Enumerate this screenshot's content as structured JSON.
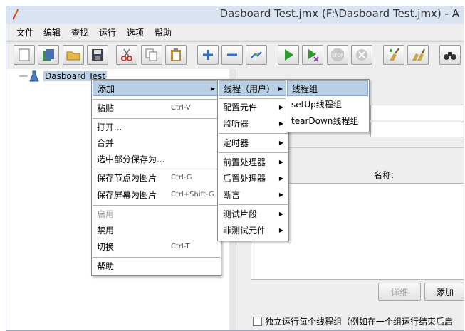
{
  "window": {
    "title": "Dasboard Test.jmx (F:\\Dasboard Test.jmx) - A"
  },
  "menubar": [
    "文件",
    "编辑",
    "查找",
    "运行",
    "选项",
    "帮助"
  ],
  "toolbar": [
    "new-icon",
    "templates-icon",
    "open-icon",
    "save-icon",
    "cut-icon",
    "copy-icon",
    "paste-icon",
    "expand-icon",
    "collapse-icon",
    "toggle-icon",
    "start-icon",
    "start-no-pause-icon",
    "stop-icon",
    "shutdown-icon",
    "clear-icon",
    "clear-all-icon",
    "search-icon"
  ],
  "tree": {
    "root": "Dasboard Test"
  },
  "context_menu": {
    "add": "添加",
    "paste": "粘贴",
    "paste_sc": "Ctrl-V",
    "open": "打开...",
    "merge": "合并",
    "save_selection": "选中部分保存为...",
    "save_node_image": "保存节点为图片",
    "save_node_image_sc": "Ctrl-G",
    "save_screen_image": "保存屏幕为图片",
    "save_screen_image_sc": "Ctrl+Shift-G",
    "enable": "启用",
    "disable": "禁用",
    "toggle": "切换",
    "toggle_sc": "Ctrl-T",
    "help": "帮助"
  },
  "add_submenu": {
    "threads": "线程（用户）",
    "config": "配置元件",
    "listener": "监听器",
    "timer": "定时器",
    "pre": "前置处理器",
    "post": "后置处理器",
    "assertion": "断言",
    "fragment": "测试片段",
    "non_test": "非测试元件"
  },
  "threads_submenu": {
    "thread_group": "线程组",
    "setup": "setUp线程组",
    "teardown": "tearDown线程组"
  },
  "right_panel": {
    "name_col": "名称:",
    "detail_btn": "详细",
    "add_btn": "添加",
    "run_independent": "独立运行每个线程组（例如在一个组运行结束后启"
  }
}
